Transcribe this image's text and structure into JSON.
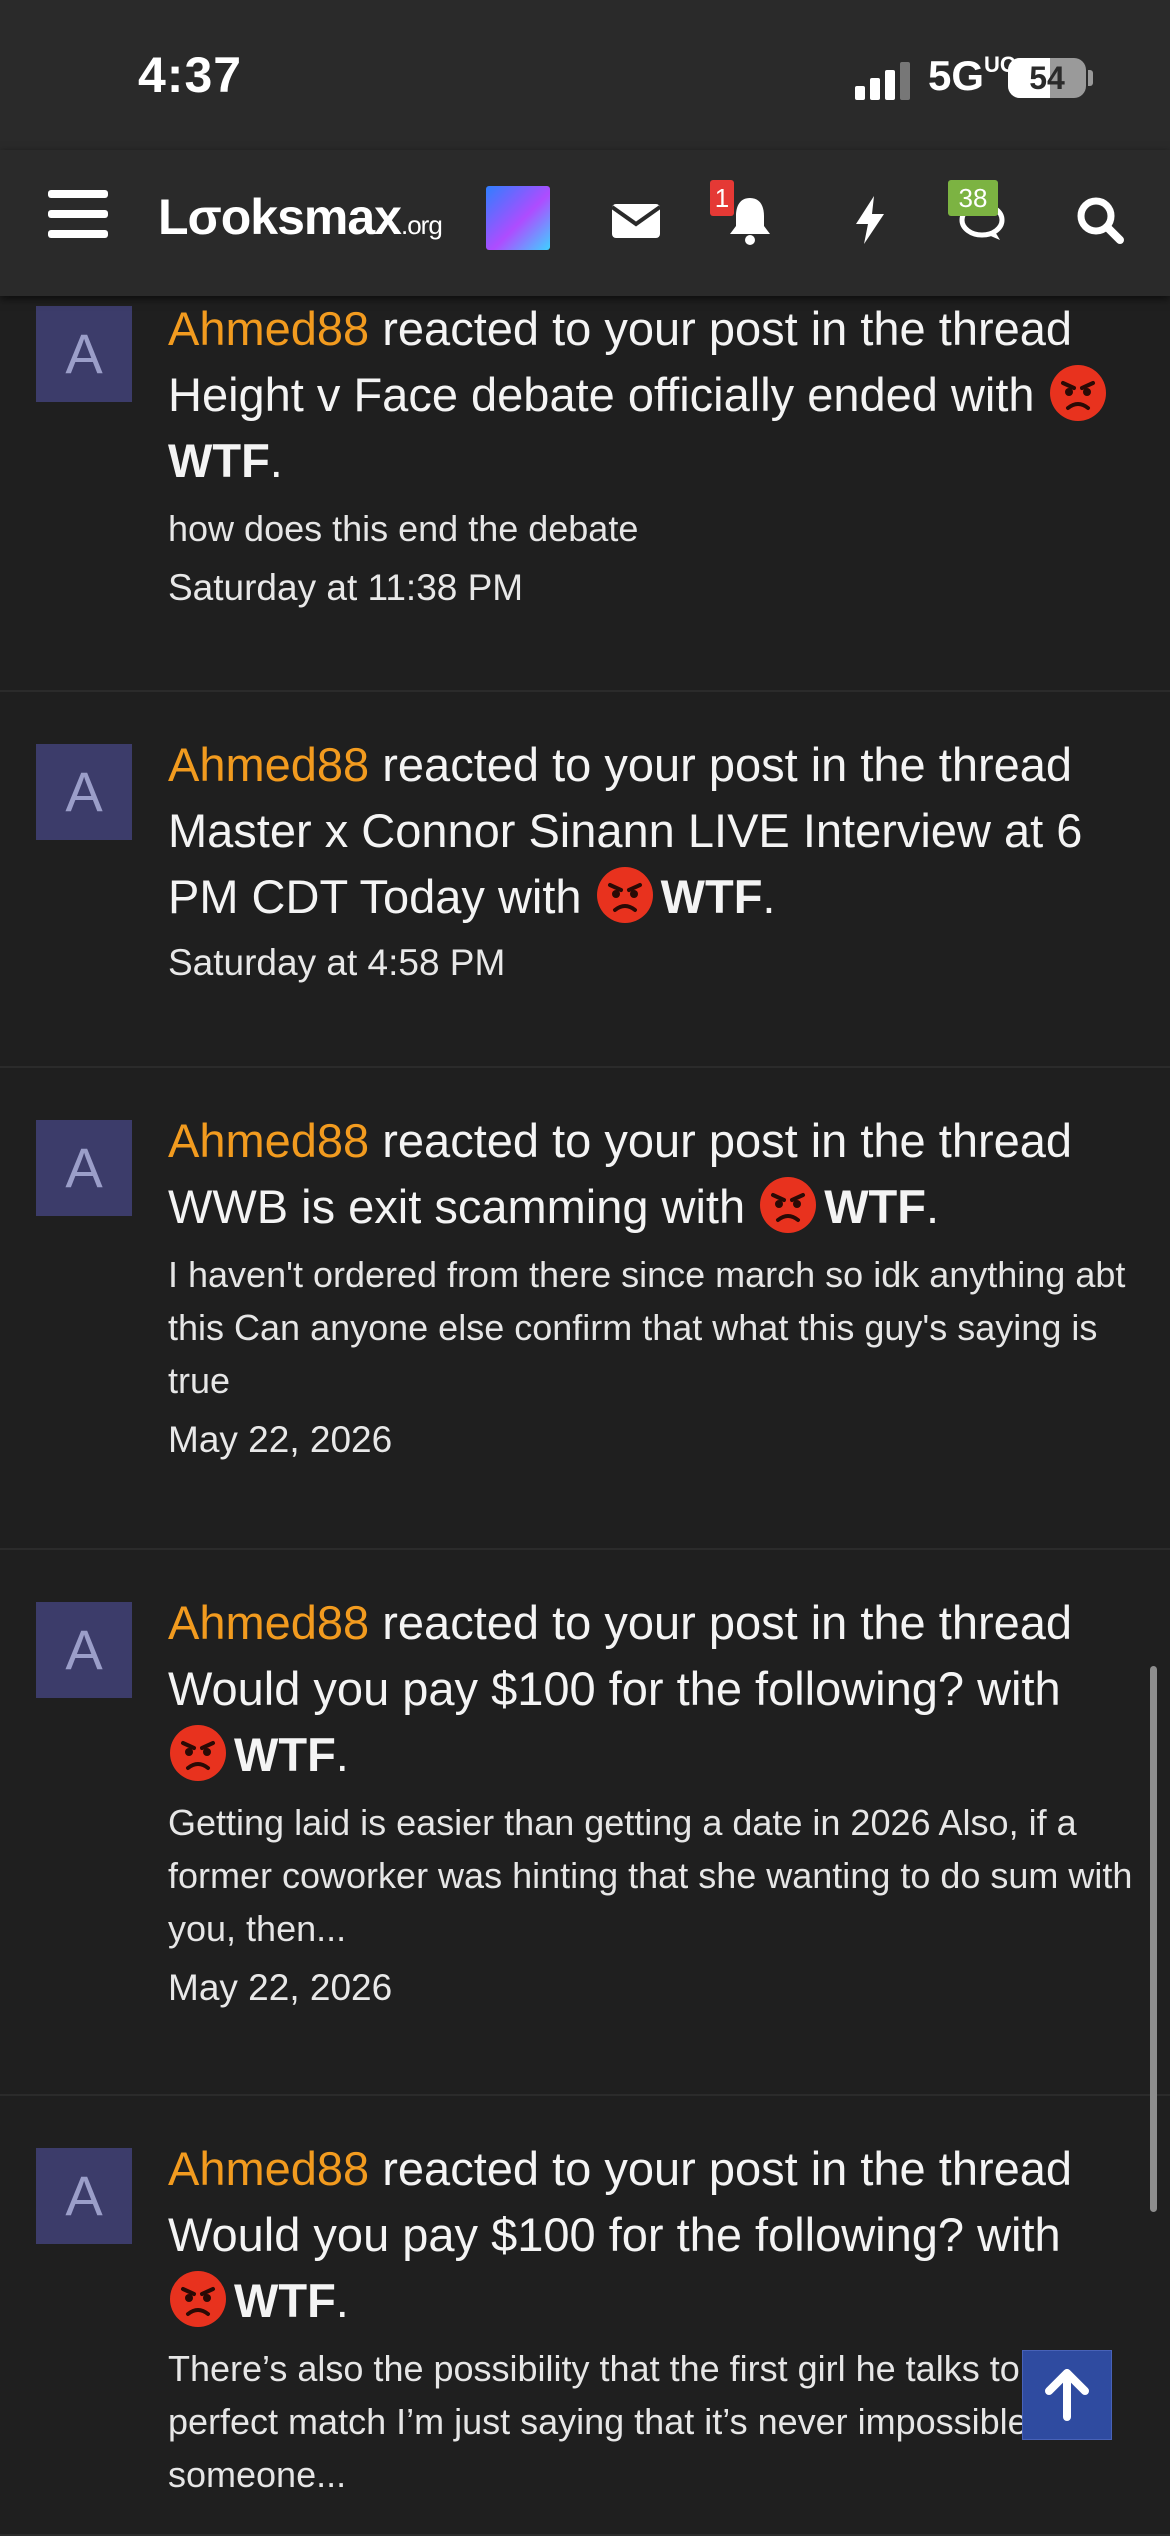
{
  "status": {
    "time": "4:37",
    "network": "5G",
    "network_suffix": "UC",
    "battery": "54",
    "battery_level": 0.54
  },
  "nav": {
    "logo_main": "Lσoksmax",
    "logo_suffix": ".org",
    "alerts_badge": "1",
    "conversations_badge": "38",
    "icons": [
      "menu-icon",
      "avatar-icon",
      "mail-icon",
      "bell-icon",
      "bolt-icon",
      "chat-icon",
      "search-icon"
    ],
    "colors": {
      "alerts_badge": "#e53935",
      "conversations_badge": "#7cb342"
    }
  },
  "alerts": [
    {
      "avatar": "A",
      "user": "Ahmed88",
      "text_before": " reacted to your post in the thread Height v Face debate officially ended with ",
      "reaction": "WTF",
      "snippet": "how does this end the debate",
      "date": "Saturday at 11:38 PM"
    },
    {
      "avatar": "A",
      "user": "Ahmed88",
      "text_before": " reacted to your post in the thread Master x Connor Sinann LIVE Interview at 6 PM CDT Today with ",
      "reaction": "WTF",
      "snippet": "",
      "date": "Saturday at 4:58 PM"
    },
    {
      "avatar": "A",
      "user": "Ahmed88",
      "text_before": " reacted to your post in the thread WWB is exit scamming with ",
      "reaction": "WTF",
      "snippet": "I haven't ordered from there since march so idk anything abt this Can anyone else confirm that what this guy's saying is true",
      "date": "May 22, 2026"
    },
    {
      "avatar": "A",
      "user": "Ahmed88",
      "text_before": " reacted to your post in the thread Would you pay $100 for the following? with ",
      "reaction": "WTF",
      "snippet": "Getting laid is easier than getting a date in 2026 Also, if a former coworker was hinting that she wanting to do sum with you, then...",
      "date": "May 22, 2026"
    },
    {
      "avatar": "A",
      "user": "Ahmed88",
      "text_before": " reacted to your post in the thread Would you pay $100 for the following? with ",
      "reaction": "WTF",
      "snippet": "There’s also the possibility that the first girl he talks to is a perfect match I’m just saying that it’s never impossible for someone...",
      "date": ""
    }
  ]
}
